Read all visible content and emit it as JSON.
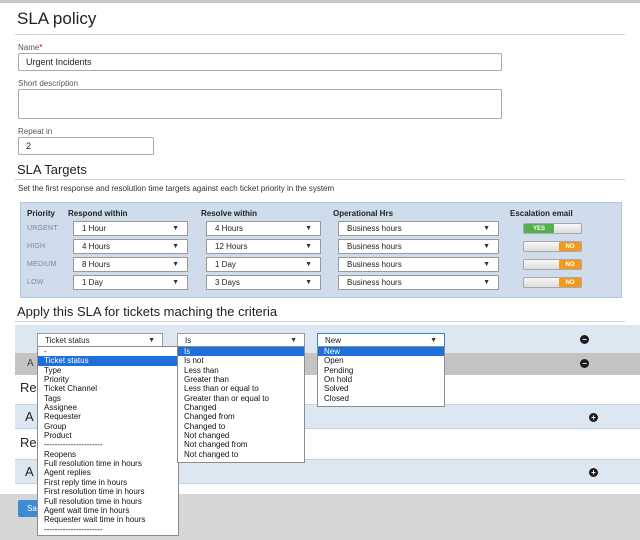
{
  "page_title": "SLA policy",
  "form": {
    "name_label": "Name",
    "name_required": "*",
    "name_value": "Urgent Incidents",
    "short_desc_label": "Short description",
    "short_desc_value": "",
    "repeat_label": "Repeat in",
    "repeat_value": "2"
  },
  "targets": {
    "heading": "SLA Targets",
    "description": "Set the first response and resolution time targets against each ticket priority in the system",
    "columns": [
      "Priority",
      "Respond within",
      "Resolve within",
      "Operational Hrs",
      "Escalation email"
    ],
    "rows": [
      {
        "priority": "URGENT",
        "respond": "1 Hour",
        "resolve": "4 Hours",
        "hours": "Business hours",
        "escalation": "YES"
      },
      {
        "priority": "HIGH",
        "respond": "4 Hours",
        "resolve": "12 Hours",
        "hours": "Business hours",
        "escalation": "NO"
      },
      {
        "priority": "MEDIUM",
        "respond": "8 Hours",
        "resolve": "1 Day",
        "hours": "Business hours",
        "escalation": "NO"
      },
      {
        "priority": "LOW",
        "respond": "1 Day",
        "resolve": "3 Days",
        "hours": "Business hours",
        "escalation": "NO"
      }
    ]
  },
  "criteria": {
    "heading": "Apply this SLA for tickets maching the criteria",
    "field_value": "Ticket status",
    "operator_value": "Is",
    "value_value": "New",
    "field_options": [
      "-",
      "Ticket status",
      "Type",
      "Priority",
      "Ticket Channel",
      "Tags",
      "Assignee",
      "Requester",
      "Group",
      "Product",
      "----------------------",
      "Reopens",
      "Full resolution time in hours",
      "Agent replies",
      "First reply time in hours",
      "First resolution time in hours",
      "Full resolution time in hours",
      "Agent wait time in hours",
      "Requester wait time in hours",
      "----------------------"
    ],
    "operator_options": [
      "Is",
      "Is not",
      "Less than",
      "Greater than",
      "Less than or equal to",
      "Greater than or equal to",
      "Changed",
      "Changed from",
      "Changed to",
      "Not changed",
      "Not changed from",
      "Not changed to"
    ],
    "value_options": [
      "New",
      "Open",
      "Pending",
      "On hold",
      "Solved",
      "Closed"
    ]
  },
  "partial": {
    "row_letter": "A",
    "section1_heading": "Re",
    "section1_bar": "A",
    "section2_heading": "Re",
    "section2_bar": "A",
    "save_label": "Sa"
  },
  "colors": {
    "accent": "#1e6fd9",
    "yes": "#53b04b",
    "no": "#f39a1c",
    "panel": "#cfdcec"
  }
}
